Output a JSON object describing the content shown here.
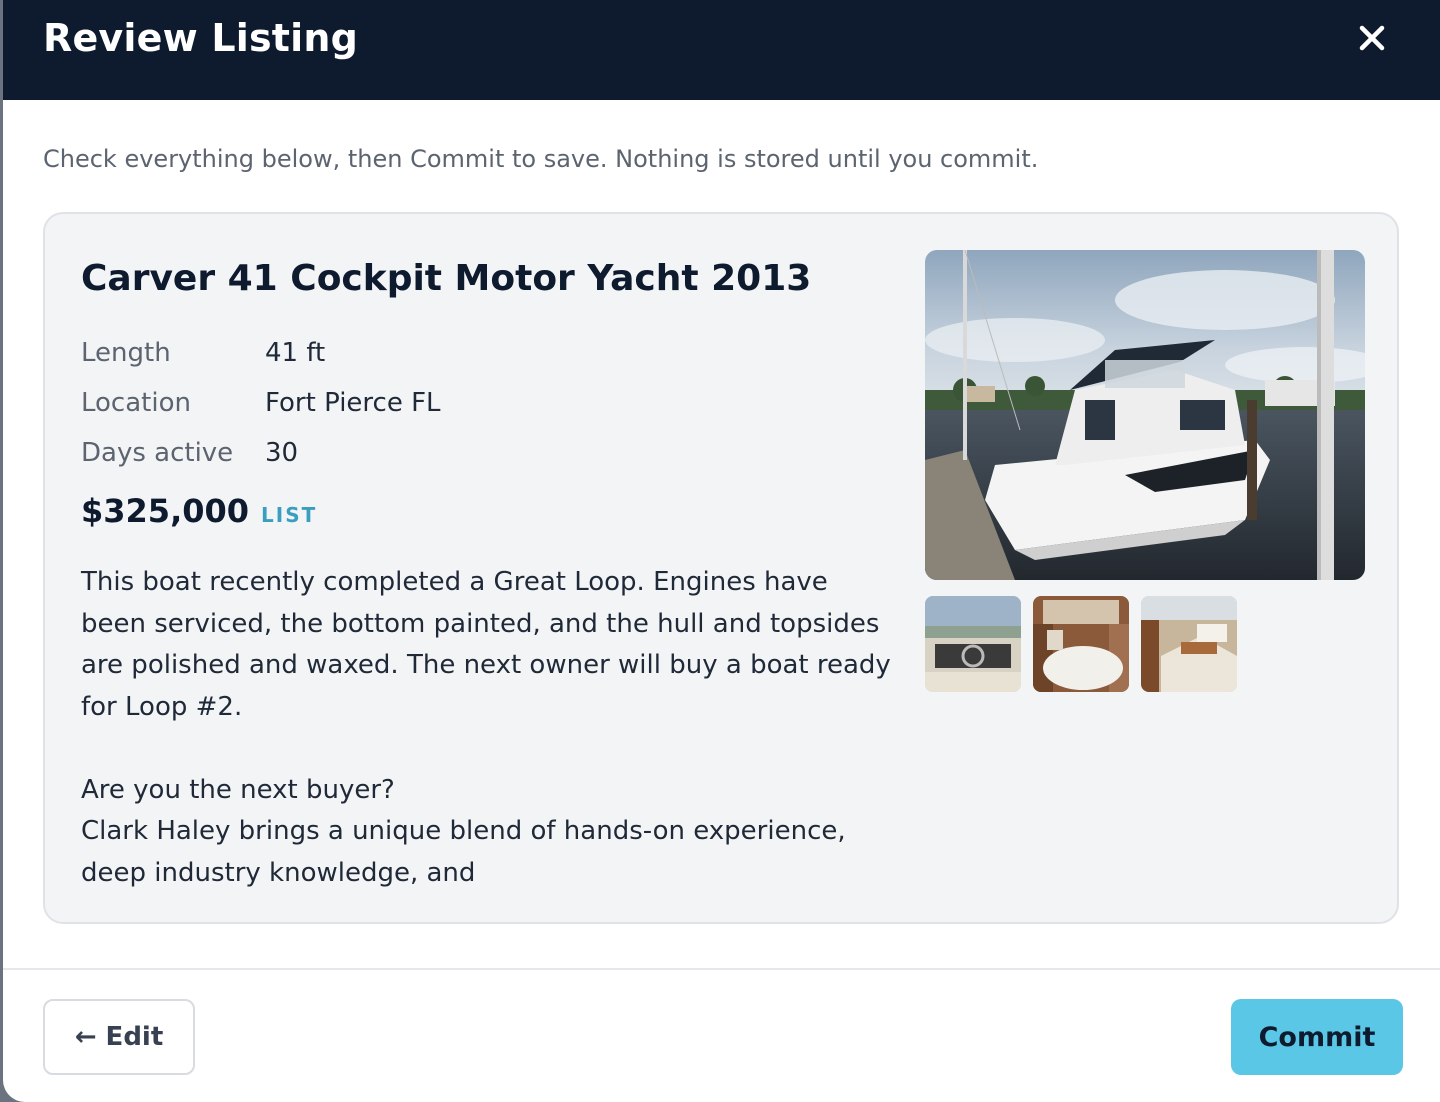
{
  "modal": {
    "title": "Review Listing",
    "close_icon": "close-icon",
    "intro": "Check everything below, then Commit to save. Nothing is stored until you commit."
  },
  "listing": {
    "title": "Carver 41 Cockpit Motor Yacht 2013",
    "specs": [
      {
        "label": "Length",
        "value": "41 ft"
      },
      {
        "label": "Location",
        "value": "Fort Pierce FL"
      },
      {
        "label": "Days active",
        "value": "30"
      }
    ],
    "price": "$325,000",
    "price_tag": "LIST",
    "description": "This boat recently completed a Great Loop. Engines have been serviced, the bottom painted, and the hull and topsides are polished and waxed. The next owner will buy a boat ready for Loop #2.\n\nAre you the next buyer?\nClark Haley brings a unique blend of hands-on experience, deep industry knowledge, and",
    "photos": {
      "main": "yacht-photo",
      "thumbnails": [
        "helm-photo",
        "cabin-photo",
        "salon-photo"
      ]
    }
  },
  "footer": {
    "edit_label": "← Edit",
    "commit_label": "Commit"
  },
  "colors": {
    "header_bg": "#0e1a2e",
    "accent": "#5bc7e6",
    "price_tag": "#3a9fbf",
    "card_bg": "#f3f4f6"
  }
}
